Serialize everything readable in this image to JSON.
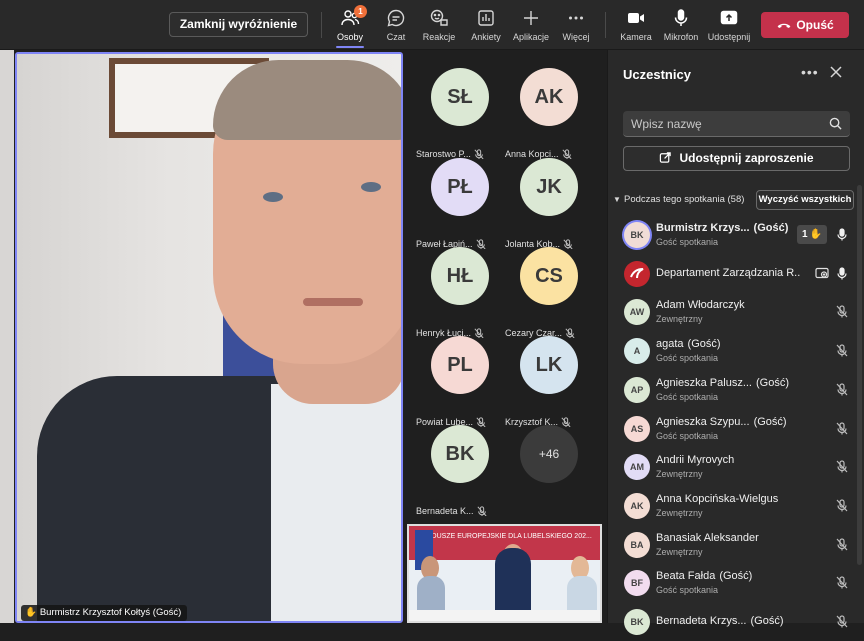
{
  "toolbar": {
    "stop_spotlight": "Zamknij wyróżnienie",
    "people": {
      "label": "Osoby",
      "badge": "1"
    },
    "chat": "Czat",
    "reactions": "Reakcje",
    "polls": "Ankiety",
    "apps": "Aplikacje",
    "more": "Więcej",
    "camera": "Kamera",
    "mic": "Mikrofon",
    "share": "Udostępnij",
    "leave": "Opuść"
  },
  "main_video": {
    "name": "Burmistrz Krzysztof Kołtyś (Gość)",
    "raised_hand": true
  },
  "gallery": [
    {
      "initials": "SŁ",
      "name": "Starostwo P...",
      "color": "#dbe8d4"
    },
    {
      "initials": "AK",
      "name": "Anna Kopci...",
      "color": "#f3ddd4"
    },
    {
      "initials": "PŁ",
      "name": "Paweł Łapiń...",
      "color": "#e2dcf6"
    },
    {
      "initials": "JK",
      "name": "Jolanta Kob...",
      "color": "#dbe8d4"
    },
    {
      "initials": "HŁ",
      "name": "Henryk Łucj...",
      "color": "#dbe8d4"
    },
    {
      "initials": "CS",
      "name": "Cezary Czar...",
      "color": "#fbe2a2"
    },
    {
      "initials": "PL",
      "name": "Powiat Lube...",
      "color": "#f6d9d4"
    },
    {
      "initials": "LK",
      "name": "Krzysztof K...",
      "color": "#d5e4ef"
    },
    {
      "initials": "BK",
      "name": "Bernadeta K...",
      "color": "#dbe8d4"
    },
    {
      "initials": "+46",
      "name": "",
      "color": "#3b3b3b"
    }
  ],
  "thumb": {
    "banner": "FUNDUSZE EUROPEJSKIE DLA LUBELSKIEGO 202..."
  },
  "panel": {
    "title": "Uczestnicy",
    "search_placeholder": "Wpisz nazwę",
    "share_invite": "Udostępnij zaproszenie",
    "section": "Podczas tego spotkania (58)",
    "lower_all": "Wyczyść wszystkich",
    "participants": [
      {
        "initials": "BK",
        "name": "Burmistrz Krzys...",
        "tag": "(Gość)",
        "sub": "Gość spotkania",
        "color": "#f0dcd6",
        "bold": true,
        "hand": "1",
        "mic": "on",
        "ring": true
      },
      {
        "initials": "",
        "name": "Departament Zarządzania R...",
        "tag": "",
        "sub": "",
        "color": "#c4262e",
        "logo": true,
        "mic": "on",
        "sharing": true
      },
      {
        "initials": "AW",
        "name": "Adam Włodarczyk",
        "tag": "",
        "sub": "Zewnętrzny",
        "color": "#dbe8d4",
        "mic": "off"
      },
      {
        "initials": "A",
        "name": "agata",
        "tag": "(Gość)",
        "sub": "Gość spotkania",
        "color": "#d8ecea",
        "mic": "off"
      },
      {
        "initials": "AP",
        "name": "Agnieszka Palusz...",
        "tag": "(Gość)",
        "sub": "Gość spotkania",
        "color": "#dbe8d4",
        "mic": "off"
      },
      {
        "initials": "AS",
        "name": "Agnieszka Szypu...",
        "tag": "(Gość)",
        "sub": "Gość spotkania",
        "color": "#f6d9d4",
        "mic": "off"
      },
      {
        "initials": "AM",
        "name": "Andrii Myrovych",
        "tag": "",
        "sub": "Zewnętrzny",
        "color": "#e2dcf6",
        "mic": "off"
      },
      {
        "initials": "AK",
        "name": "Anna Kopcińska-Wielgus",
        "tag": "",
        "sub": "Zewnętrzny",
        "color": "#f3ddd4",
        "mic": "off"
      },
      {
        "initials": "BA",
        "name": "Banasiak Aleksander",
        "tag": "",
        "sub": "Zewnętrzny",
        "color": "#f3ddd4",
        "mic": "off"
      },
      {
        "initials": "BF",
        "name": "Beata Fałda",
        "tag": "(Gość)",
        "sub": "Gość spotkania",
        "color": "#f2dcef",
        "mic": "off"
      },
      {
        "initials": "BK",
        "name": "Bernadeta Krzys...",
        "tag": "(Gość)",
        "sub": "",
        "color": "#dbe8d4",
        "mic": "off"
      }
    ]
  }
}
